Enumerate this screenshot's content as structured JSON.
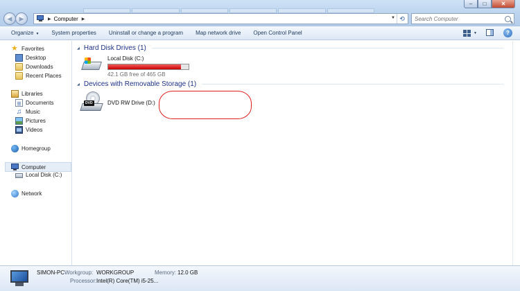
{
  "window": {
    "minimize_glyph": "–",
    "maximize_glyph": "□",
    "close_glyph": "✕"
  },
  "address": {
    "location": "Computer",
    "search_placeholder": "Search Computer"
  },
  "toolbar": {
    "organize": "Organize",
    "system_properties": "System properties",
    "uninstall": "Uninstall or change a program",
    "map_drive": "Map network drive",
    "control_panel": "Open Control Panel",
    "help_glyph": "?"
  },
  "nav": {
    "favorites": "Favorites",
    "desktop": "Desktop",
    "downloads": "Downloads",
    "recent_places": "Recent Places",
    "libraries": "Libraries",
    "documents": "Documents",
    "music": "Music",
    "pictures": "Pictures",
    "videos": "Videos",
    "homegroup": "Homegroup",
    "computer": "Computer",
    "local_disk": "Local Disk (C:)",
    "network": "Network"
  },
  "content": {
    "hdd_group": "Hard Disk Drives (1)",
    "removable_group": "Devices with Removable Storage (1)",
    "local_disk_name": "Local Disk (C:)",
    "local_disk_free": "42.1 GB free of 465 GB",
    "local_disk_used_fraction": 0.909,
    "dvd_name": "DVD RW Drive (D:)",
    "dvd_logo": "DVD"
  },
  "details": {
    "pc_name": "SIMON-PC",
    "workgroup_label": "Workgroup:",
    "workgroup_value": "WORKGROUP",
    "memory_label": "Memory:",
    "memory_value": "12.0 GB",
    "processor_label": "Processor:",
    "processor_value": "Intel(R) Core(TM) i5-25..."
  },
  "colors": {
    "accent": "#1e3287",
    "capacity_fill": "#c80000",
    "annotation": "#e01b1b"
  }
}
